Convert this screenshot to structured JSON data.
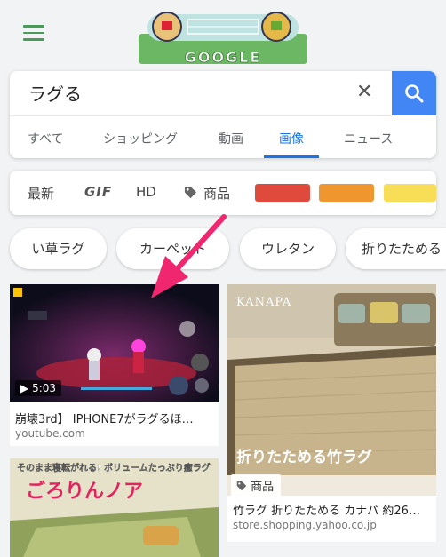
{
  "header": {
    "menu_icon": "hamburger-menu-icon",
    "doodle_text": "GOOGLE"
  },
  "search": {
    "query": "ラグる",
    "clear_icon": "close-icon",
    "search_icon": "search-icon"
  },
  "tabs": [
    {
      "label": "すべて",
      "active": false
    },
    {
      "label": "ショッピング",
      "active": false
    },
    {
      "label": "動画",
      "active": false
    },
    {
      "label": "画像",
      "active": true
    },
    {
      "label": "ニュース",
      "active": false
    }
  ],
  "filters": {
    "latest": "最新",
    "gif": "GIF",
    "hd": "HD",
    "products": "商品",
    "tag_icon": "tag-icon"
  },
  "colors": {
    "accent": "#4285f4",
    "swatch_red": "#e04a3c",
    "swatch_orange": "#f0962e",
    "swatch_yellow": "#f8de57",
    "arrow": "#f0266e"
  },
  "chips": [
    "い草ラグ",
    "カーペット",
    "ウレタン",
    "折りたためる"
  ],
  "results": [
    {
      "caption": "崩壊3rd】 IPHONE7がラグるほ…",
      "source": "youtube.com",
      "duration": "5:03",
      "play_icon": "play-icon"
    },
    {
      "caption": "竹ラグ 折りたためる カナパ 約26…",
      "source": "store.shopping.yahoo.co.jp",
      "badge": "商品",
      "brand": "KANAPA",
      "overlay_text": "折りたためる竹ラグ"
    },
    {
      "overlay_top": "そのまま寝転がれる! ボリュームたっぷり癒ラグ",
      "overlay_title": "ごろりんノア"
    }
  ]
}
